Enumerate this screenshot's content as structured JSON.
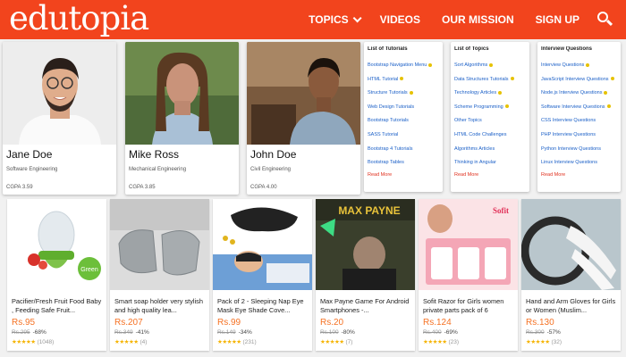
{
  "header": {
    "logo": "edutopia",
    "nav": [
      {
        "label": "TOPICS",
        "has_dropdown": true
      },
      {
        "label": "VIDEOS",
        "has_dropdown": false
      },
      {
        "label": "OUR MISSION",
        "has_dropdown": false
      },
      {
        "label": "SIGN UP",
        "has_dropdown": false
      }
    ],
    "search_icon": "search-icon"
  },
  "colors": {
    "header_bg": "#f2441d",
    "price": "#f57224",
    "star": "#f5b301",
    "link": "#1a5fc7",
    "link_more": "#e0301e"
  },
  "profiles": [
    {
      "name": "Jane Doe",
      "role": "Software Engineering",
      "cgpa": "CGPA 3.59"
    },
    {
      "name": "Mike Ross",
      "role": "Mechanical Engineering",
      "cgpa": "CGPA 3.85"
    },
    {
      "name": "John Doe",
      "role": "Civil Engineering",
      "cgpa": "CGPA 4.00"
    }
  ],
  "link_lists": [
    {
      "title": "List of Tutorials",
      "items": [
        "Bootstrap Navigation Menu",
        "HTML Tutorial",
        "Structure Tutorials",
        "Web Design Tutorials",
        "Bootstrap Tutorials",
        "SASS Tutorial",
        "Bootstrap 4 Tutorials",
        "Bootstrap Tables"
      ],
      "more": "Read More"
    },
    {
      "title": "List of Topics",
      "items": [
        "Sort Algorithms",
        "Data Structures Tutorials",
        "Technology Articles",
        "Scheme Programming",
        "Other Topics",
        "HTML Code Challenges",
        "Algorithms Articles",
        "Thinking in Angular"
      ],
      "more": "Read More"
    },
    {
      "title": "Interview Questions",
      "items": [
        "Interview Questions",
        "JavaScript Interview Questions",
        "Node.js Interview Questions",
        "Software Interview Questions",
        "CSS Interview Questions",
        "PHP Interview Questions",
        "Python Interview Questions",
        "Linux Interview Questions"
      ],
      "more": "Read More"
    }
  ],
  "products": [
    {
      "title": "Pacifier/Fresh Fruit Food Baby , Feeding Safe Fruit...",
      "price": "Rs.95",
      "old_price": "Rs.295",
      "discount": "-68%",
      "rating": 4.5,
      "stars": "★★★★★",
      "reviews": "(1048)",
      "img_label": "Green"
    },
    {
      "title": "Smart soap holder very stylish and high quality lea...",
      "price": "Rs.207",
      "old_price": "Rs.349",
      "discount": "-41%",
      "rating": 4.5,
      "stars": "★★★★★",
      "reviews": "(4)",
      "img_label": ""
    },
    {
      "title": "Pack of 2 - Sleeping Nap Eye Mask Eye Shade Cove...",
      "price": "Rs.99",
      "old_price": "Rs.149",
      "discount": "-34%",
      "rating": 4.5,
      "stars": "★★★★★",
      "reviews": "(231)",
      "img_label": ""
    },
    {
      "title": "Max Payne Game For Android Smartphones -...",
      "price": "Rs.20",
      "old_price": "Rs.100",
      "discount": "-80%",
      "rating": 4.5,
      "stars": "★★★★★",
      "reviews": "(7)",
      "img_label": "MAX PAYNE"
    },
    {
      "title": "Sofit Razor for Girls women private parts pack of 6",
      "price": "Rs.124",
      "old_price": "Rs.400",
      "discount": "-69%",
      "rating": 4.5,
      "stars": "★★★★★",
      "reviews": "(23)",
      "img_label": "Sofit"
    },
    {
      "title": "Hand and Arm Gloves for Girls or Women (Muslim...",
      "price": "Rs.130",
      "old_price": "Rs.300",
      "discount": "-57%",
      "rating": 4.5,
      "stars": "★★★★★",
      "reviews": "(32)",
      "img_label": ""
    }
  ]
}
